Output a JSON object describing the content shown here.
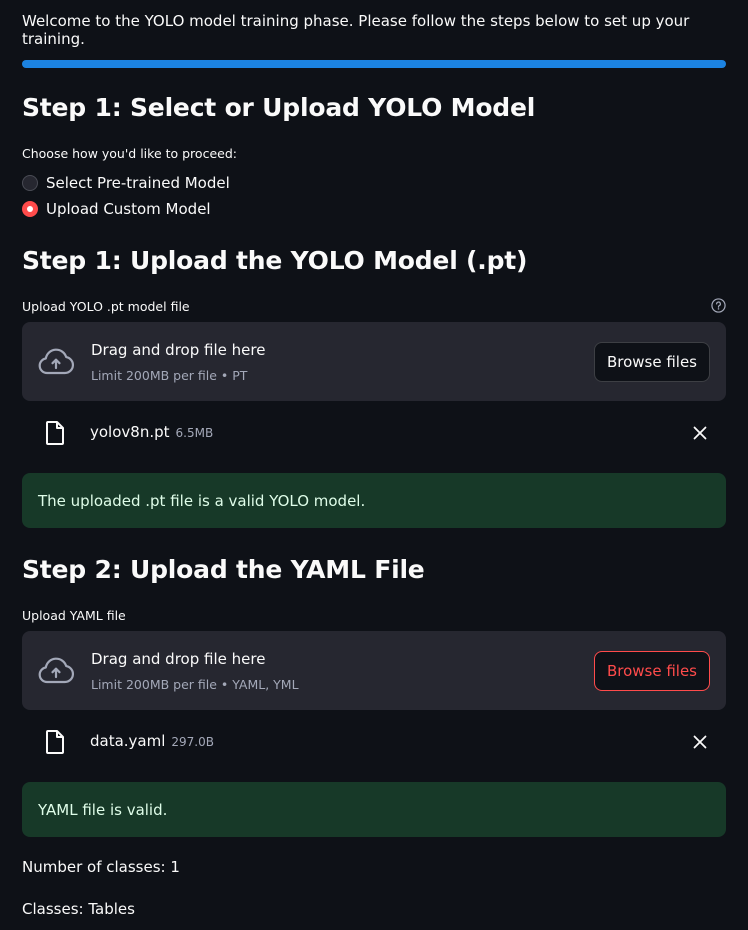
{
  "intro": "Welcome to the YOLO model training phase. Please follow the steps below to set up your training.",
  "progress": 1.0,
  "step1": {
    "heading": "Step 1: Select or Upload YOLO Model",
    "choice_label": "Choose how you'd like to proceed:",
    "options": [
      {
        "label": "Select Pre-trained Model",
        "selected": false
      },
      {
        "label": "Upload Custom Model",
        "selected": true
      }
    ]
  },
  "upload_model": {
    "heading": "Step 1: Upload the YOLO Model (.pt)",
    "field_label": "Upload YOLO .pt model file",
    "dropzone_title": "Drag and drop file here",
    "dropzone_limit": "Limit 200MB per file • PT",
    "browse_label": "Browse files",
    "file_name": "yolov8n.pt",
    "file_size": "6.5MB",
    "success_message": "The uploaded .pt file is a valid YOLO model."
  },
  "step2": {
    "heading": "Step 2: Upload the YAML File",
    "field_label": "Upload YAML file",
    "dropzone_title": "Drag and drop file here",
    "dropzone_limit": "Limit 200MB per file • YAML, YML",
    "browse_label": "Browse files",
    "file_name": "data.yaml",
    "file_size": "297.0B",
    "success_message": "YAML file is valid."
  },
  "results": {
    "num_classes": "Number of classes: 1",
    "classes": "Classes: Tables"
  },
  "icons": {
    "upload": "cloud-upload-icon",
    "file": "file-icon",
    "close": "close-icon",
    "help": "help-icon"
  },
  "colors": {
    "background": "#0e1117",
    "accent": "#ff4b4b",
    "progress": "#1c83e1",
    "success_bg": "#173928",
    "dropzone_bg": "#262730"
  }
}
